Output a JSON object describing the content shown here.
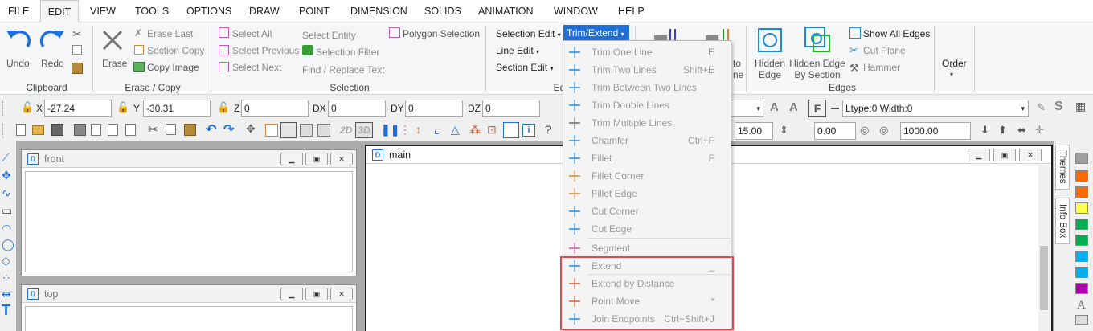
{
  "menu": [
    "FILE",
    "EDIT",
    "VIEW",
    "TOOLS",
    "OPTIONS",
    "DRAW",
    "POINT",
    "DIMENSION",
    "SOLIDS",
    "ANIMATION",
    "WINDOW",
    "HELP"
  ],
  "active_menu": "EDIT",
  "ribbon": {
    "undo": "Undo",
    "redo": "Redo",
    "clipboard_group": "Clipboard",
    "erase": "Erase",
    "erase_last": "Erase Last",
    "section_copy": "Section Copy",
    "copy_image": "Copy Image",
    "erase_copy_group": "Erase / Copy",
    "select_all": "Select All",
    "select_previous": "Select Previous",
    "select_next": "Select Next",
    "select_entity": "Select Entity",
    "selection_filter": "Selection Filter",
    "find_replace": "Find / Replace Text",
    "polygon_selection": "Polygon Selection",
    "selection_group": "Selection",
    "selection_edit": "Selection Edit",
    "line_edit": "Line Edit",
    "section_edit": "Section Edit",
    "trim_extend": "Trim/Extend",
    "edit_group_partial": "Ed",
    "hidden_partial_1": "to",
    "hidden_partial_2": "ne",
    "hidden_edge": [
      "Hidden",
      "Edge"
    ],
    "hidden_edge_by_section": [
      "Hidden Edge",
      "By Section"
    ],
    "show_all_edges": "Show All Edges",
    "cut_plane": "Cut Plane",
    "hammer": "Hammer",
    "edges_group": "Edges",
    "order": "Order"
  },
  "coords": {
    "x_label": "X",
    "x_value": "-27.24",
    "y_label": "Y",
    "y_value": "-30.31",
    "z_label": "Z",
    "z_value": "0",
    "dx_label": "DX",
    "dx_value": "0",
    "dy_label": "DY",
    "dy_value": "0",
    "dz_label": "DZ",
    "dz_value": "0",
    "ltype": "Ltype:0  Width:0"
  },
  "toolbar2": {
    "btn_2d": "2D",
    "btn_3d": "3D",
    "val1": "15.00",
    "val2": "0.00",
    "val3": "1000.00"
  },
  "windows": {
    "front": "front",
    "top": "top",
    "main": "main"
  },
  "side_tabs": [
    "Themes",
    "Info Box"
  ],
  "palette_colors": [
    "#9e9e9e",
    "#ff6a00",
    "#ff6a00",
    "#ffff4d",
    "#00b050",
    "#00b050",
    "#00b0f0",
    "#00b0f0",
    "#b000b0"
  ],
  "dropdown": [
    {
      "label": "Trim One Line",
      "shortcut": "E"
    },
    {
      "label": "Trim Two Lines",
      "shortcut": "Shift+E"
    },
    {
      "label": "Trim Between Two Lines",
      "shortcut": ""
    },
    {
      "label": "Trim Double Lines",
      "shortcut": ""
    },
    {
      "label": "Trim Multiple Lines",
      "shortcut": ""
    },
    {
      "label": "Chamfer",
      "shortcut": "Ctrl+F"
    },
    {
      "label": "Fillet",
      "shortcut": "F"
    },
    {
      "label": "Fillet Corner",
      "shortcut": ""
    },
    {
      "label": "Fillet Edge",
      "shortcut": ""
    },
    {
      "label": "Cut Corner",
      "shortcut": ""
    },
    {
      "label": "Cut Edge",
      "shortcut": ""
    },
    {
      "label": "Segment",
      "shortcut": ""
    },
    {
      "label": "Extend",
      "shortcut": "_"
    },
    {
      "label": "Extend by Distance",
      "shortcut": ""
    },
    {
      "label": "Point Move",
      "shortcut": "*"
    },
    {
      "label": "Join Endpoints",
      "shortcut": "Ctrl+Shift+J"
    }
  ]
}
